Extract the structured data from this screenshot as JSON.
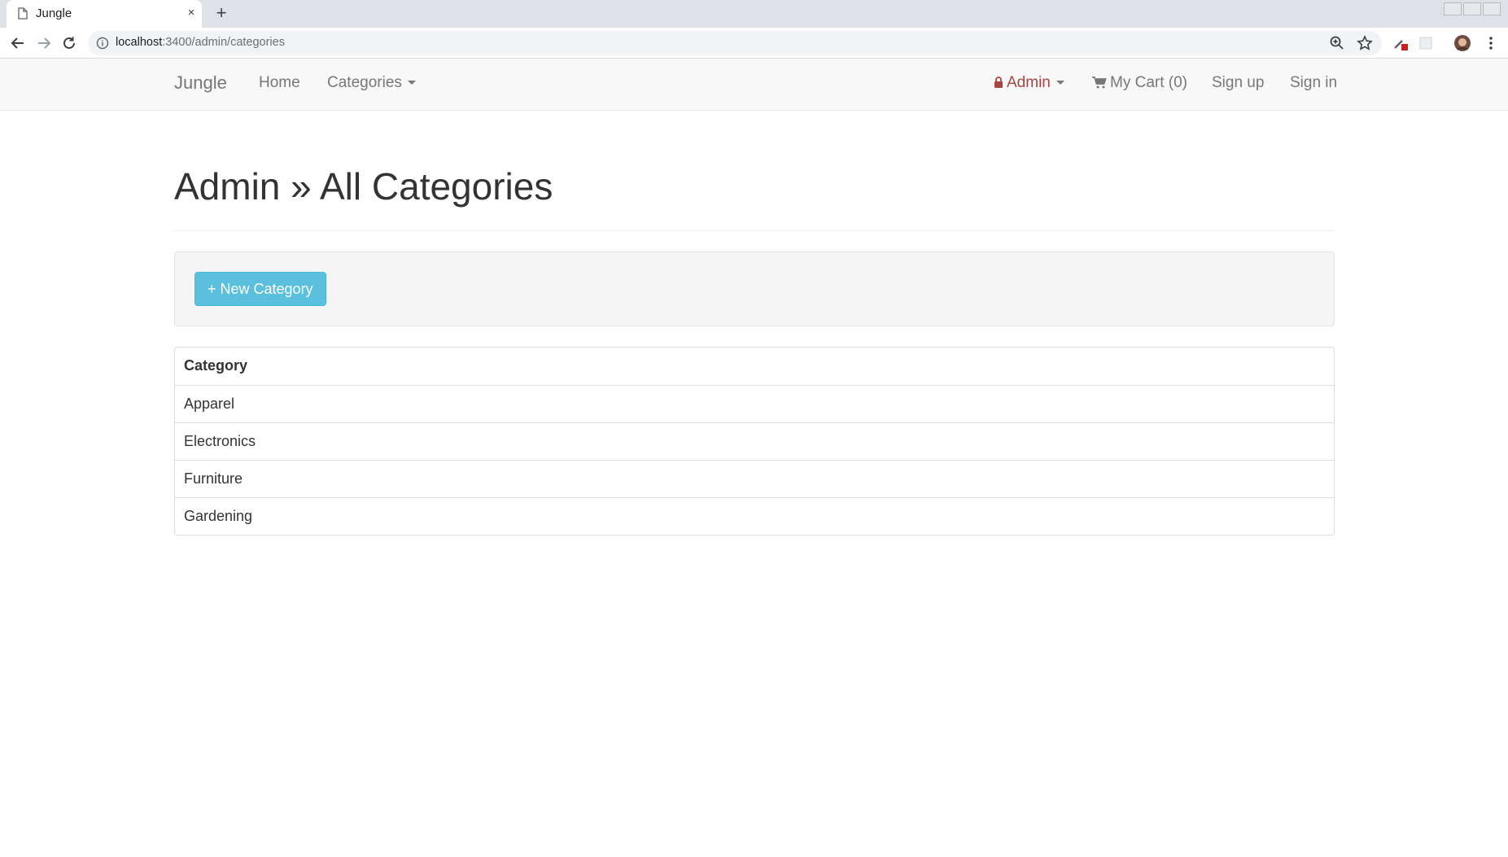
{
  "browser": {
    "tab_title": "Jungle",
    "tab_close_glyph": "×",
    "new_tab_glyph": "+",
    "url_host": "localhost",
    "url_rest": ":3400/admin/categories"
  },
  "navbar": {
    "brand": "Jungle",
    "home": "Home",
    "categories": "Categories",
    "admin": "Admin",
    "cart": "My Cart (0)",
    "signup": "Sign up",
    "signin": "Sign in",
    "admin_color": "#a94442",
    "link_color": "#777777"
  },
  "page": {
    "title": "Admin » All Categories",
    "new_button": "+ New Category",
    "button_color": "#5bc0de"
  },
  "table": {
    "header": "Category",
    "rows": [
      "Apparel",
      "Electronics",
      "Furniture",
      "Gardening"
    ]
  },
  "icons": [
    "file-icon",
    "close-icon",
    "plus-icon",
    "back-arrow-icon",
    "forward-arrow-icon",
    "reload-icon",
    "info-icon",
    "zoom-icon",
    "star-icon",
    "extension-icon",
    "profile-avatar-icon",
    "menu-dots-icon",
    "lock-icon",
    "cart-icon"
  ]
}
